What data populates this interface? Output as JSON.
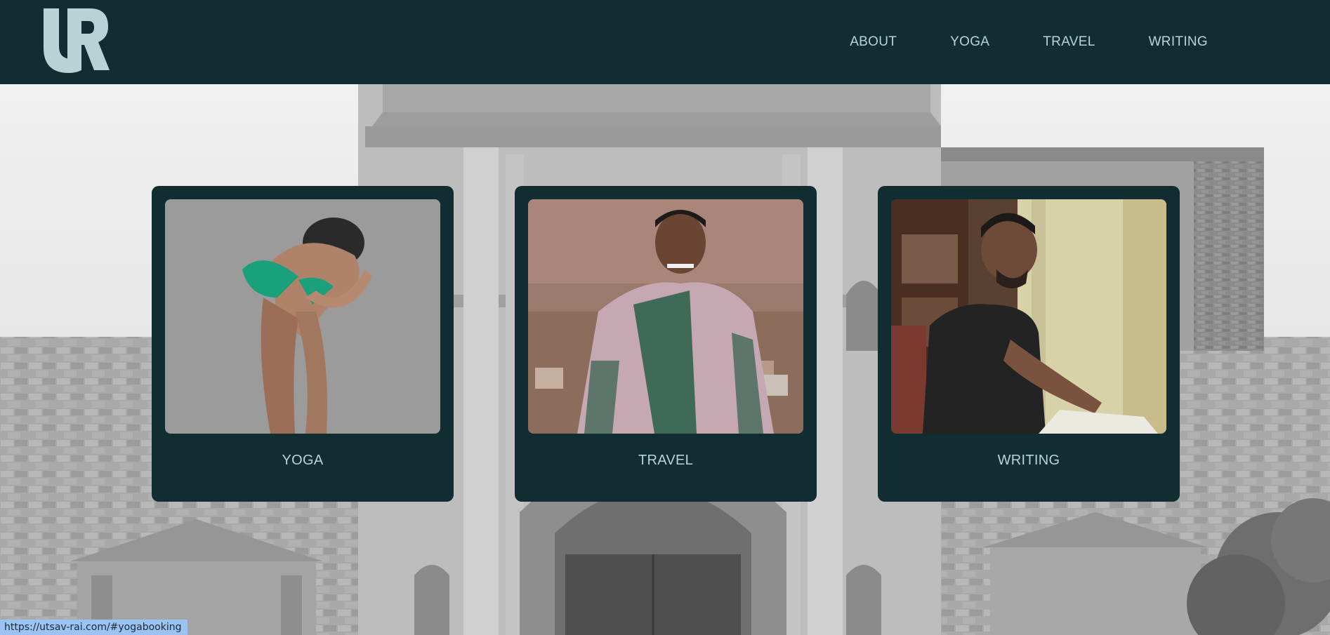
{
  "header": {
    "logo_text": "UR",
    "nav": [
      {
        "label": "ABOUT"
      },
      {
        "label": "YOGA"
      },
      {
        "label": "TRAVEL"
      },
      {
        "label": "WRITING"
      }
    ]
  },
  "cards": [
    {
      "label": "YOGA",
      "image": "yoga-pose-photo"
    },
    {
      "label": "TRAVEL",
      "image": "travel-portrait-photo"
    },
    {
      "label": "WRITING",
      "image": "writing-portrait-photo"
    }
  ],
  "status_bar": {
    "url": "https://utsav-rai.com/#yogabooking"
  },
  "colors": {
    "header_bg": "#112d32",
    "nav_text": "#b6d4d8",
    "card_bg": "#112d32",
    "status_bg": "#9bc3f3"
  }
}
